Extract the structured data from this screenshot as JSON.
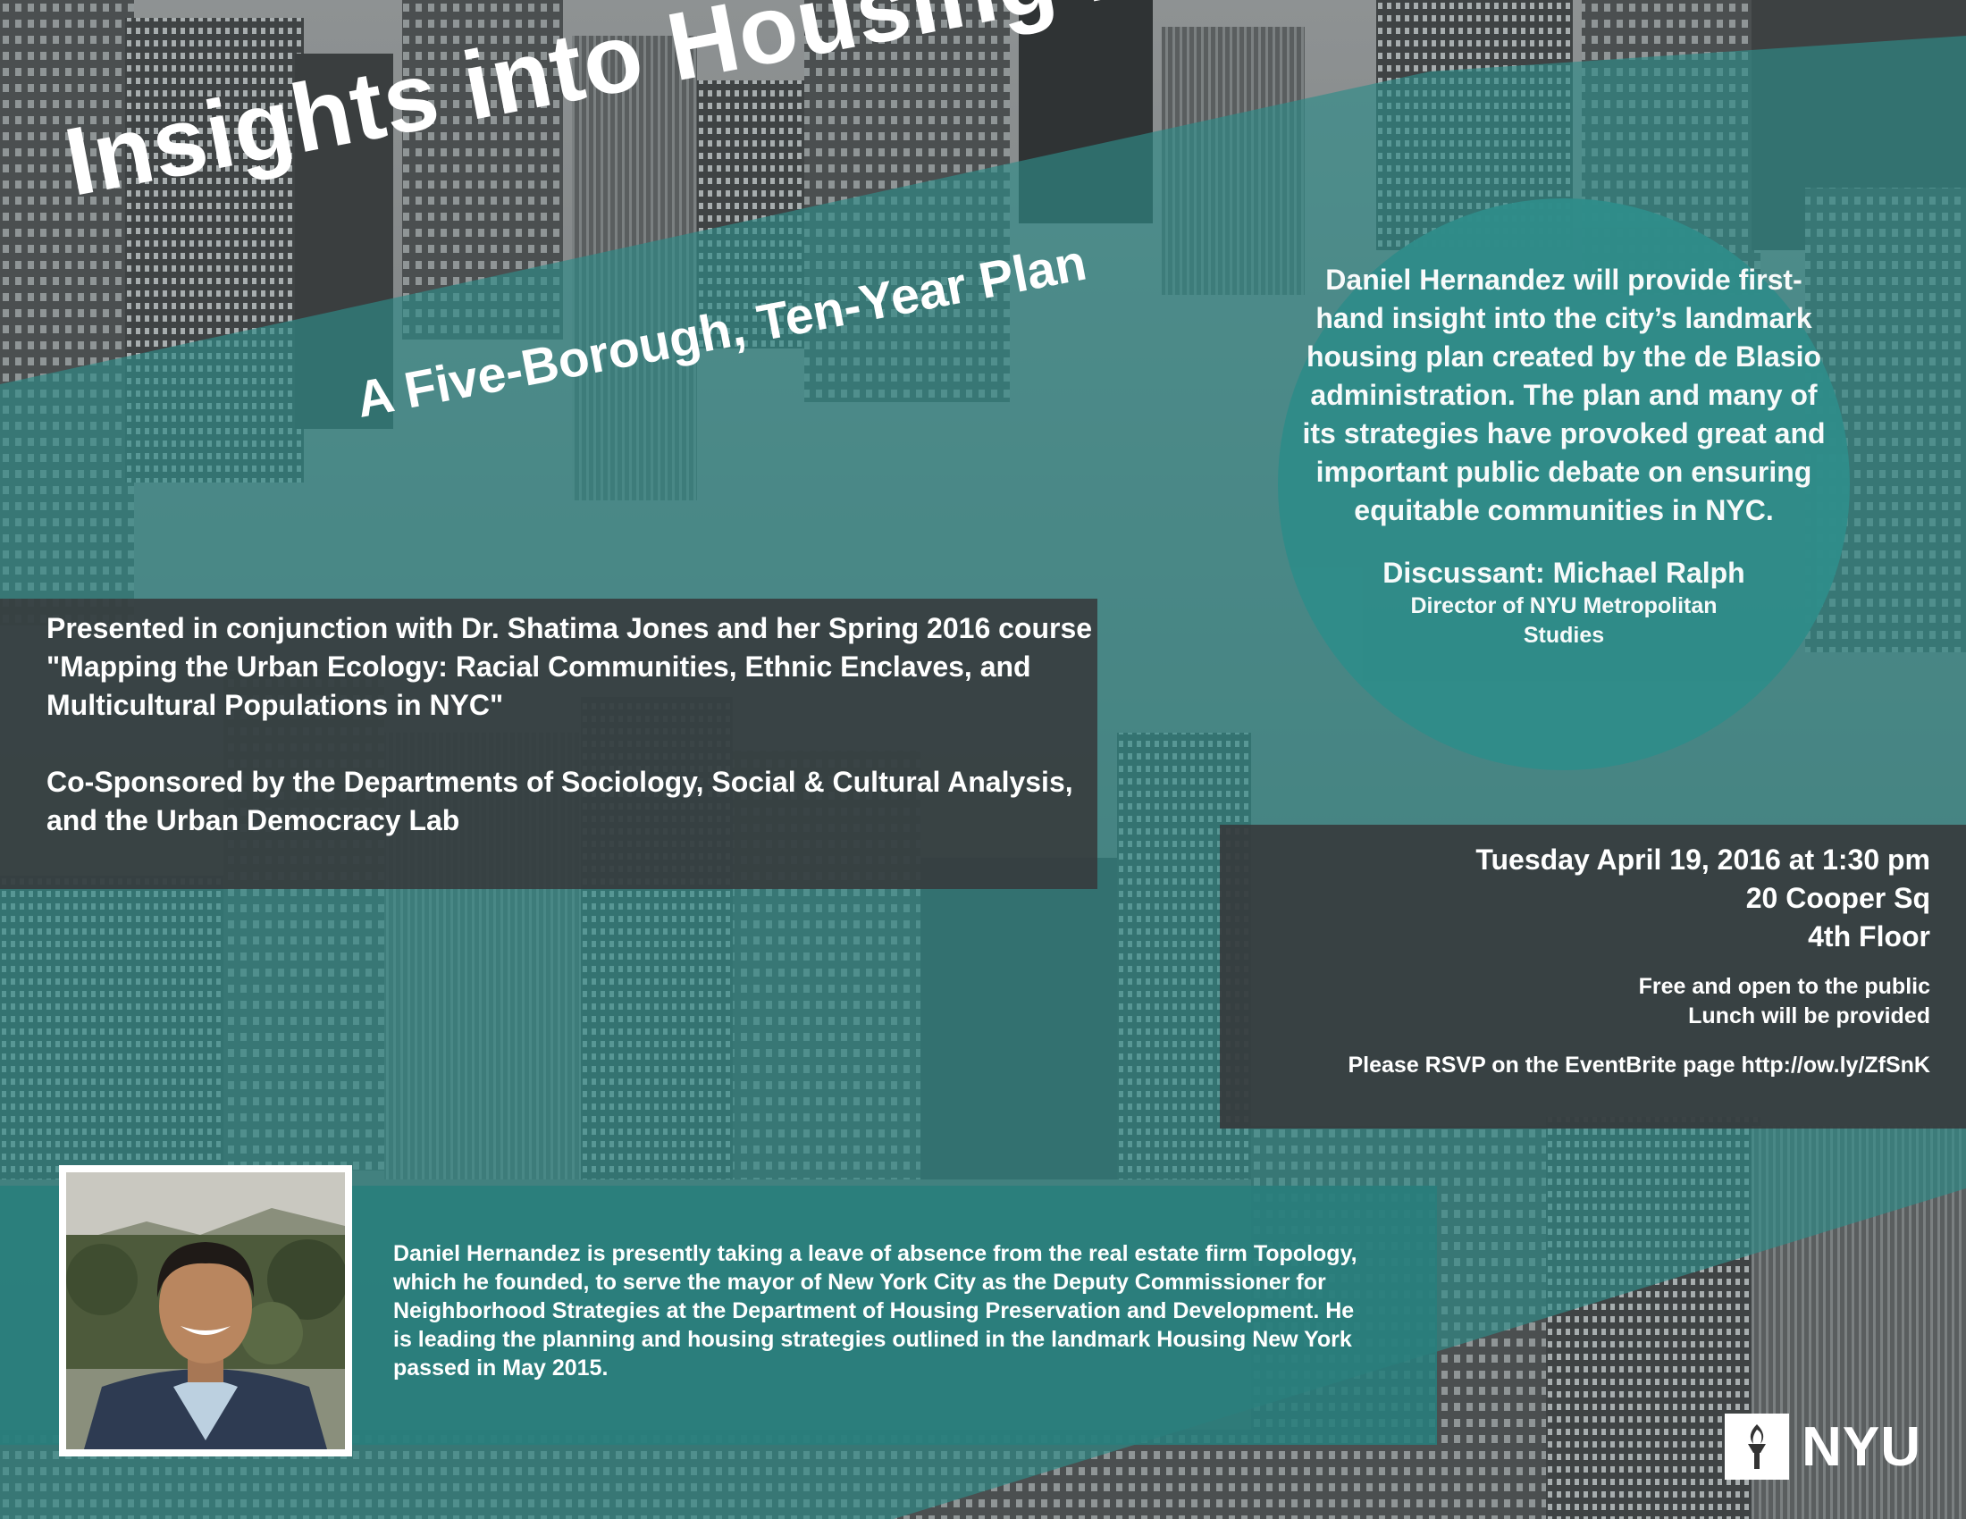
{
  "title": "Insights into Housing New York:",
  "subtitle": "A Five-Borough, Ten-Year Plan",
  "highlight": {
    "description": "Daniel Hernandez will provide first-hand insight into the city’s landmark housing plan created by the de Blasio administration. The plan and many of its strategies have provoked great and important public debate on ensuring equitable communities in NYC.",
    "discussant": "Discussant: Michael Ralph",
    "discussant_role": "Director of NYU Metropolitan Studies"
  },
  "presented": {
    "course_note": "Presented in conjunction with Dr. Shatima Jones and her Spring 2016 course \"Mapping the Urban Ecology: Racial Communities, Ethnic Enclaves, and Multicultural Populations in NYC\"",
    "cosponsors": "Co-Sponsored by the Departments of Sociology, Social & Cultural Analysis, and the Urban Democracy Lab"
  },
  "event": {
    "datetime": "Tuesday April 19, 2016 at 1:30 pm",
    "address": "20 Cooper Sq",
    "floor": "4th Floor",
    "free_note": "Free and open to the public",
    "lunch_note": "Lunch will be provided",
    "rsvp": "Please RSVP on the EventBrite page http://ow.ly/ZfSnK"
  },
  "bio": {
    "text": "Daniel Hernandez is presently taking a leave of absence from the real estate firm Topology, which he founded, to serve the mayor of New York City as the Deputy Commissioner for Neighborhood Strategies at the Department of Housing Preservation and Development.  He is leading the planning and housing strategies outlined in the landmark Housing New York passed in May 2015."
  },
  "logo": {
    "text": "NYU",
    "icon": "torch-icon"
  },
  "colors": {
    "teal": "#2f8c89",
    "dark_panel": "#37383a",
    "text": "#ffffff"
  }
}
